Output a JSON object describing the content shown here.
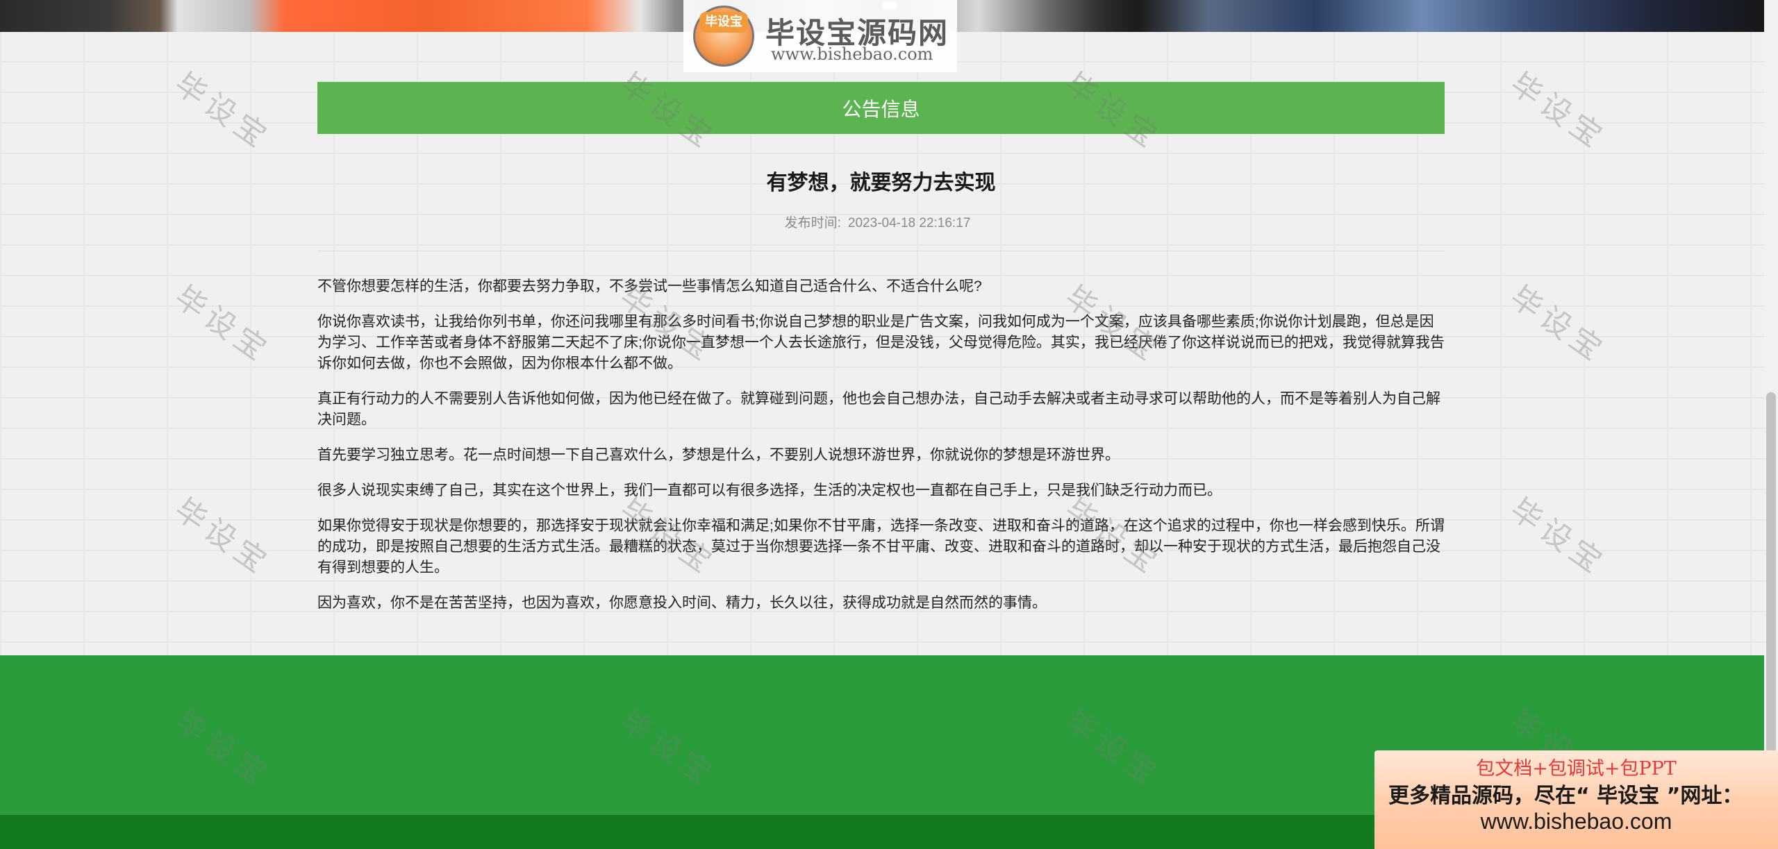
{
  "logo": {
    "title": "毕设宝源码网",
    "url": "www.bishebao.com",
    "badge_text": "毕设宝"
  },
  "notice": {
    "header": "公告信息",
    "title": "有梦想，就要努力去实现",
    "publish_label": "发布时间:",
    "publish_time": "2023-04-18 22:16:17",
    "paragraphs": [
      "不管你想要怎样的生活，你都要去努力争取，不多尝试一些事情怎么知道自己适合什么、不适合什么呢?",
      "你说你喜欢读书，让我给你列书单，你还问我哪里有那么多时间看书;你说自己梦想的职业是广告文案，问我如何成为一个文案，应该具备哪些素质;你说你计划晨跑，但总是因为学习、工作辛苦或者身体不舒服第二天起不了床;你说你一直梦想一个人去长途旅行，但是没钱，父母觉得危险。其实，我已经厌倦了你这样说说而已的把戏，我觉得就算我告诉你如何去做，你也不会照做，因为你根本什么都不做。",
      "真正有行动力的人不需要别人告诉他如何做，因为他已经在做了。就算碰到问题，他也会自己想办法，自己动手去解决或者主动寻求可以帮助他的人，而不是等着别人为自己解决问题。",
      "首先要学习独立思考。花一点时间想一下自己喜欢什么，梦想是什么，不要别人说想环游世界，你就说你的梦想是环游世界。",
      "很多人说现实束缚了自己，其实在这个世界上，我们一直都可以有很多选择，生活的决定权也一直都在自己手上，只是我们缺乏行动力而已。",
      "如果你觉得安于现状是你想要的，那选择安于现状就会让你幸福和满足;如果你不甘平庸，选择一条改变、进取和奋斗的道路，在这个追求的过程中，你也一样会感到快乐。所谓的成功，即是按照自己想要的生活方式生活。最糟糕的状态，莫过于当你想要选择一条不甘平庸、改变、进取和奋斗的道路时，却以一种安于现状的方式生活，最后抱怨自己没有得到想要的人生。",
      "因为喜欢，你不是在苦苦坚持，也因为喜欢，你愿意投入时间、精力，长久以往，获得成功就是自然而然的事情。"
    ]
  },
  "watermark": {
    "text": "毕设宝"
  },
  "promo": {
    "line1": "包文档+包调试+包PPT",
    "line2": "更多精品源码，尽在“ 毕设宝 ”网址：",
    "line3": "www.bishebao.com"
  },
  "colors": {
    "notice_bar": "#5cb451",
    "footer": "#2a9c3c",
    "footer_bottom": "#137a1f"
  }
}
